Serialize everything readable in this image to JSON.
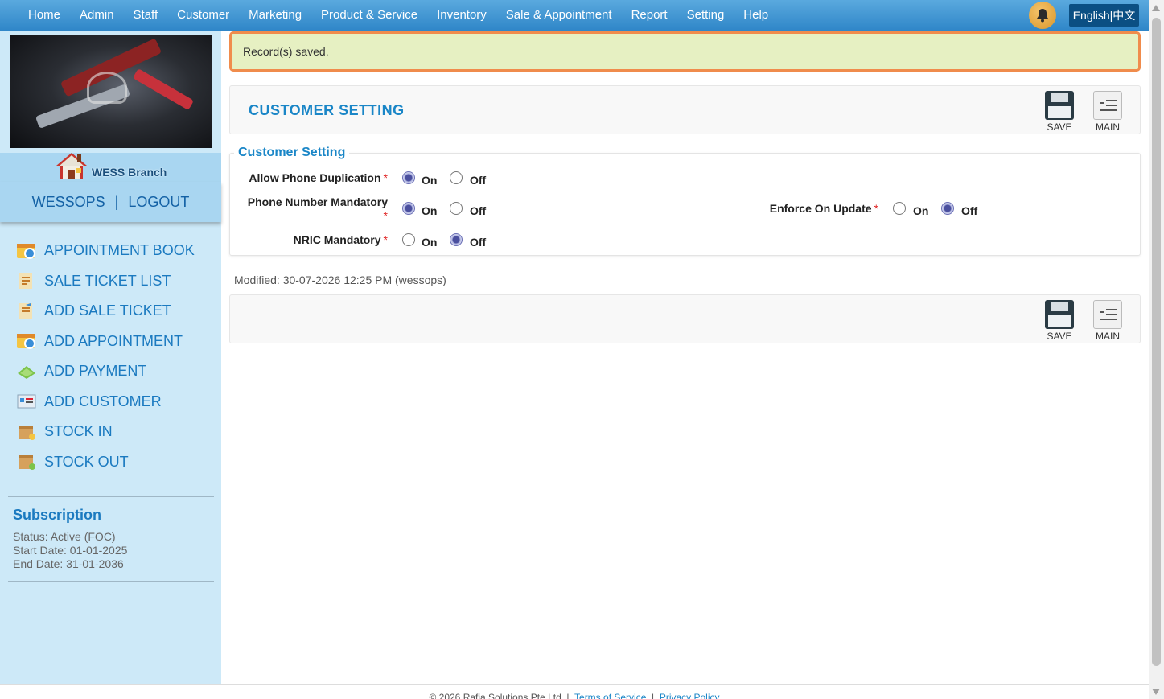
{
  "nav": {
    "items": [
      "Home",
      "Admin",
      "Staff",
      "Customer",
      "Marketing",
      "Product & Service",
      "Inventory",
      "Sale & Appointment",
      "Report",
      "Setting",
      "Help"
    ],
    "language": "English|中文"
  },
  "sidebar": {
    "branch_name": "WESS Branch",
    "username": "WESSOPS",
    "logout_label": "LOGOUT",
    "separator": "|",
    "menu": [
      {
        "label": "APPOINTMENT BOOK",
        "icon": "calendar-icon"
      },
      {
        "label": "SALE TICKET LIST",
        "icon": "ticket-list-icon"
      },
      {
        "label": "ADD SALE TICKET",
        "icon": "ticket-add-icon"
      },
      {
        "label": "ADD APPOINTMENT",
        "icon": "calendar-add-icon"
      },
      {
        "label": "ADD PAYMENT",
        "icon": "payment-icon"
      },
      {
        "label": "ADD CUSTOMER",
        "icon": "customer-card-icon"
      },
      {
        "label": "STOCK IN",
        "icon": "box-in-icon"
      },
      {
        "label": "STOCK OUT",
        "icon": "box-out-icon"
      }
    ],
    "subscription": {
      "title": "Subscription",
      "status": "Status: Active (FOC)",
      "start": "Start Date: 01-01-2025",
      "end": "End Date: 31-01-2036"
    }
  },
  "alert": {
    "message": "Record(s) saved."
  },
  "page": {
    "title": "CUSTOMER SETTING",
    "save_label": "SAVE",
    "main_label": "MAIN"
  },
  "form": {
    "legend": "Customer Setting",
    "fields": [
      {
        "label": "Allow Phone Duplication",
        "value": "On"
      },
      {
        "label": "Phone Number Mandatory",
        "value": "On"
      },
      {
        "label": "NRIC Mandatory",
        "value": "Off"
      },
      {
        "label": "Enforce On Update",
        "value": "Off"
      }
    ],
    "on_label": "On",
    "off_label": "Off",
    "required_mark": "*"
  },
  "modified": "Modified: 30-07-2026 12:25 PM (wessops)",
  "footer": {
    "copyright": "© 2026 Rafia Solutions Pte Ltd",
    "terms": "Terms of Service",
    "privacy": "Privacy Policy"
  }
}
